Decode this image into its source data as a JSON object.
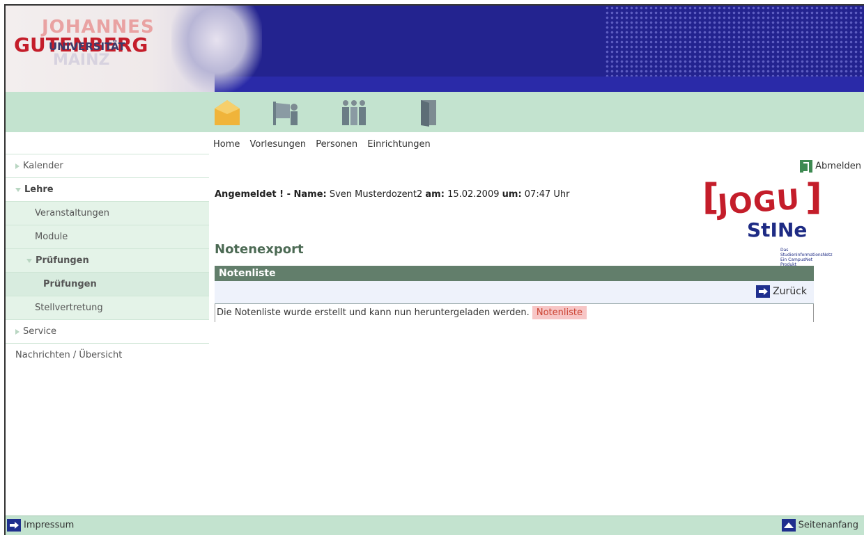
{
  "logo": {
    "line1": "JOHANNES",
    "line2": "GUTENBERG",
    "line3": "UNIVERSITÄT",
    "line4": "MAINZ"
  },
  "nav": {
    "icons": [
      "home-icon",
      "flag-icon",
      "people-icon",
      "door-icon"
    ],
    "links": [
      "Home",
      "Vorlesungen",
      "Personen",
      "Einrichtungen"
    ]
  },
  "sidebar": {
    "items": [
      {
        "label": "Kalender"
      },
      {
        "label": "Lehre"
      },
      {
        "label": "Veranstaltungen"
      },
      {
        "label": "Module"
      },
      {
        "label": "Prüfungen"
      },
      {
        "label": "Prüfungen"
      },
      {
        "label": "Stellvertretung"
      },
      {
        "label": "Service"
      },
      {
        "label": "Nachrichten / Übersicht"
      }
    ]
  },
  "header": {
    "logout": "Abmelden"
  },
  "login": {
    "prefix": "Angemeldet ! - ",
    "name_label": "Name:",
    "name": "Sven Musterdozent2",
    "date_label": "am:",
    "date": "15.02.2009",
    "time_label": "um:",
    "time": "07:47 Uhr"
  },
  "brand": {
    "text": "JOGU",
    "sub": "StINe",
    "small1": "Das StudienInformationsNetz",
    "small2": "Ein CampusNet Produkt"
  },
  "main": {
    "title": "Notenexport",
    "panel_title": "Notenliste",
    "back_label": "Zurück",
    "message": "Die Notenliste wurde erstellt und kann nun heruntergeladen werden.",
    "download_link": "Notenliste"
  },
  "footer": {
    "imprint": "Impressum",
    "top": "Seitenanfang"
  },
  "colors": {
    "header_blue": "#23238f",
    "green_band": "#c3e3cf",
    "panel_head": "#627e6b",
    "link_bg": "#f7c6c6",
    "brand_red": "#c41d2a"
  }
}
